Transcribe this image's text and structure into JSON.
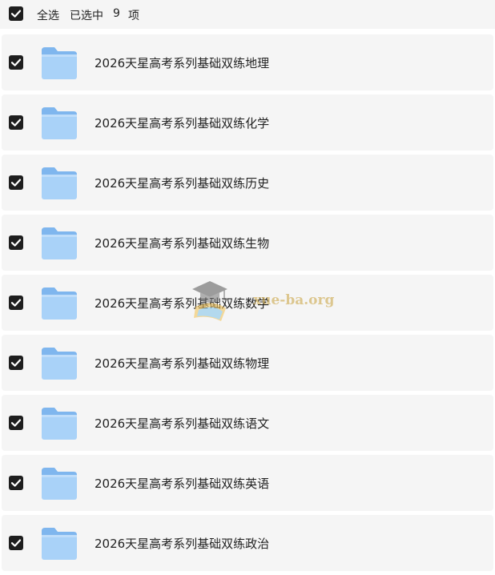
{
  "header": {
    "select_all_label": "全选",
    "selected_prefix": "已选中",
    "selected_count": "9",
    "selected_suffix": "项"
  },
  "items": [
    {
      "name": "2026天星高考系列基础双练地理",
      "checked": true,
      "icon": "folder-icon"
    },
    {
      "name": "2026天星高考系列基础双练化学",
      "checked": true,
      "icon": "folder-icon"
    },
    {
      "name": "2026天星高考系列基础双练历史",
      "checked": true,
      "icon": "folder-icon"
    },
    {
      "name": "2026天星高考系列基础双练生物",
      "checked": true,
      "icon": "folder-icon"
    },
    {
      "name": "2026天星高考系列基础双练数学",
      "checked": true,
      "icon": "folder-icon"
    },
    {
      "name": "2026天星高考系列基础双练物理",
      "checked": true,
      "icon": "folder-icon"
    },
    {
      "name": "2026天星高考系列基础双练语文",
      "checked": true,
      "icon": "folder-icon"
    },
    {
      "name": "2026天星高考系列基础双练英语",
      "checked": true,
      "icon": "folder-icon"
    },
    {
      "name": "2026天星高考系列基础双练政治",
      "checked": true,
      "icon": "folder-icon"
    }
  ],
  "watermark": {
    "text": "xue-ba.org"
  },
  "colors": {
    "row_background": "#f5f5f5",
    "checkbox_fill": "#1e1e1e",
    "folder_light": "#a9d2f8",
    "folder_dark": "#7fb6ee",
    "watermark": "#c9a13a"
  }
}
